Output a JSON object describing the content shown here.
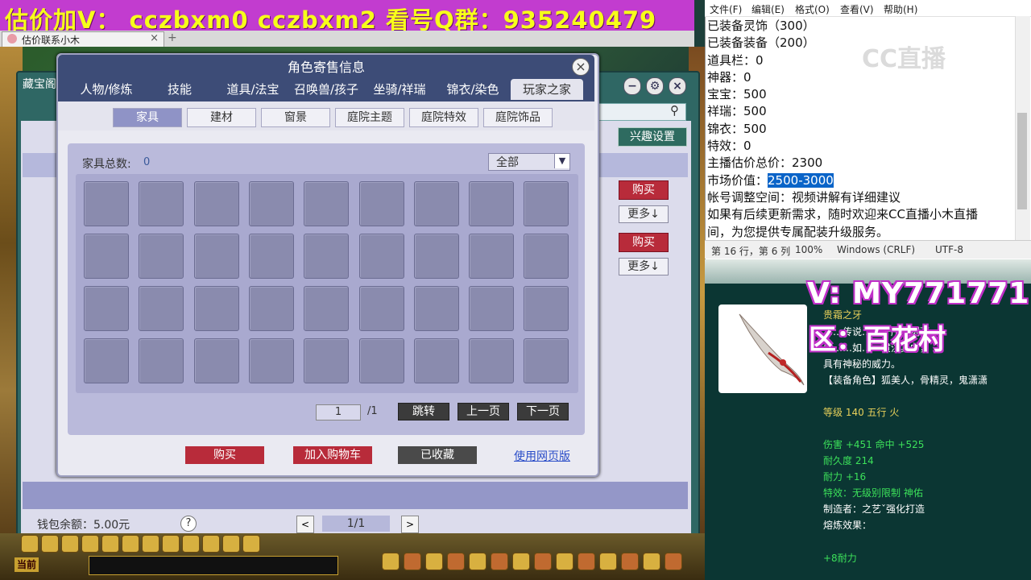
{
  "banner": {
    "text": "估价加V：  cczbxm0   cczbxm2   看号Q群：935240479"
  },
  "browser": {
    "tab_title": "估价联系小木",
    "tab_close": "×",
    "new_tab": "+"
  },
  "back_window": {
    "title": "藏宝阁",
    "interest_button": "兴趣设置",
    "buy_label": "购买",
    "more_label": "更多↓",
    "wallet_label": "钱包余额：5.00元",
    "help": "?",
    "pager": "1/1",
    "prev": "<",
    "next": ">"
  },
  "dialog": {
    "title": "角色寄售信息",
    "close": "×",
    "main_tabs": [
      "人物/修炼",
      "技能",
      "道具/法宝",
      "召唤兽/孩子",
      "坐骑/祥瑞",
      "锦衣/染色",
      "玩家之家"
    ],
    "active_main_tab": "玩家之家",
    "sub_tabs": [
      "家具",
      "建材",
      "窗景",
      "庭院主题",
      "庭院特效",
      "庭院饰品"
    ],
    "active_sub_tab": "家具",
    "count_label": "家具总数:",
    "count_value": "0",
    "filter_value": "全部",
    "page_current": "1",
    "page_total": "/1",
    "jump": "跳转",
    "prev_page": "上一页",
    "next_page": "下一页",
    "buy": "购买",
    "add_cart": "加入购物车",
    "favorited": "已收藏",
    "web_version": "使用网页版"
  },
  "notepad": {
    "menu": [
      "文件(F)",
      "编辑(E)",
      "格式(O)",
      "查看(V)",
      "帮助(H)"
    ],
    "lines": [
      "已装备灵饰（300）",
      "已装备装备（200）",
      "道具栏：0",
      "神器：0",
      "宝宝：500",
      "祥瑞：500",
      "锦衣：500",
      "特效：0",
      "主播估价总价：2300"
    ],
    "market_label": "市场价值：",
    "market_value": "2500-3000",
    "lines_after": [
      "帐号调整空间：视频讲解有详细建议",
      "如果有后续更新需求，随时欢迎来CC直播小木直播",
      "间，为您提供专属配装升级服务。"
    ],
    "status": [
      "第 16 行，第 6 列",
      "100%",
      "Windows (CRLF)",
      "UTF-8"
    ],
    "watermark": "CC直播"
  },
  "item": {
    "name": "贵霜之牙",
    "desc": [
      "……传说……牙所雕刻而",
      "成……如……贯注其中，",
      "具有神秘的威力。",
      "【装备角色】狐美人，骨精灵，鬼潇潇"
    ],
    "level": "等级 140  五行 火",
    "attack": "伤害 +451  命中 +525",
    "durability": "耐久度 214",
    "endurance": "耐力 +16",
    "effect": "特效：无级别限制 神佑",
    "maker": "制造者：之艺ˇ强化打造",
    "forge": "熔炼效果：",
    "forge_val": "+8耐力"
  },
  "overlay": {
    "v": "V: MY771771",
    "area": "区：百花村"
  },
  "colors": {
    "banner_bg": "#c23ccf",
    "banner_text": "#f7ff1a",
    "dialog_head": "#3d4c77",
    "highlight": "#0a64c8"
  }
}
